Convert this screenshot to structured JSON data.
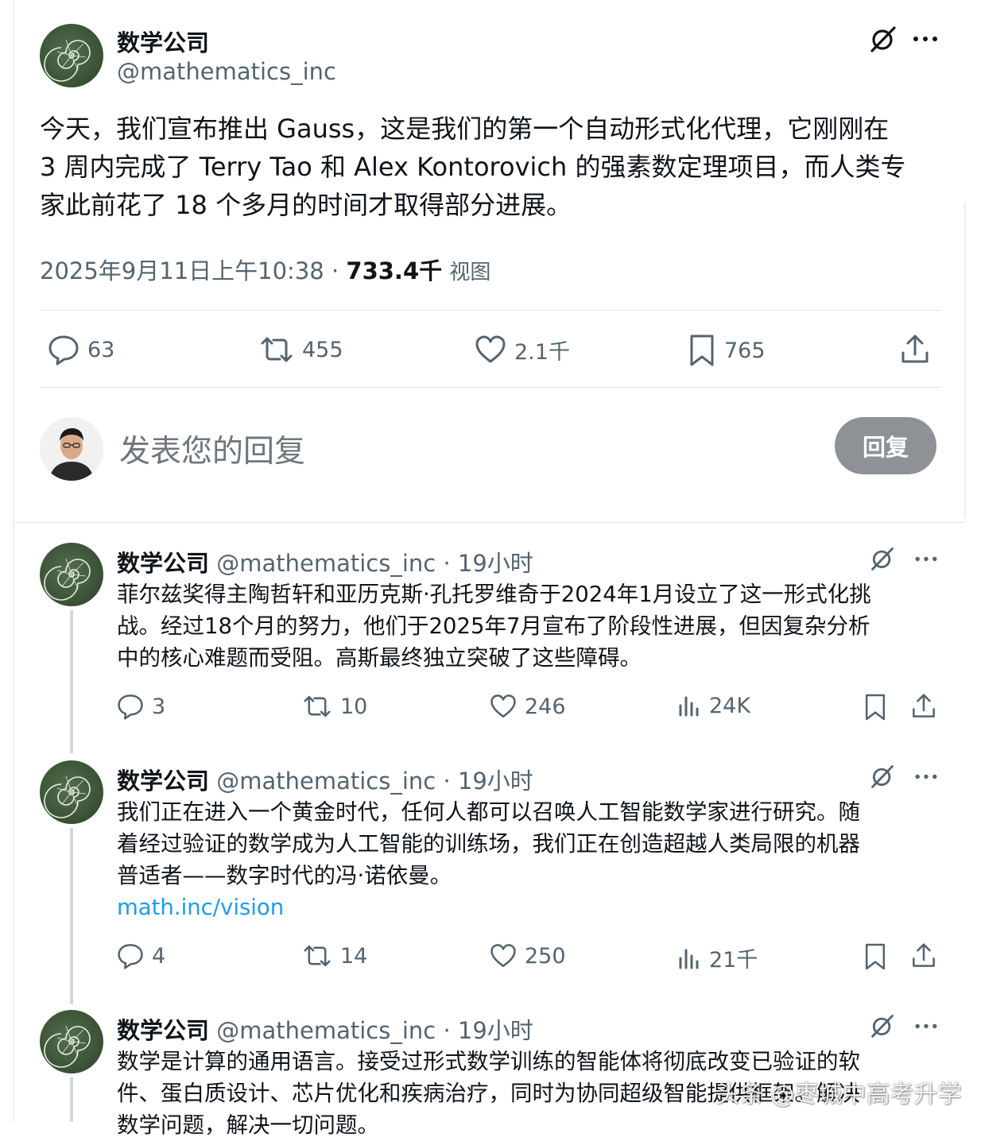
{
  "main_post": {
    "display_name": "数学公司",
    "handle": "@mathematics_inc",
    "text_lines": [
      "今天，我们宣布推出 Gauss，这是我们的第一个自动形式化代理，它刚刚在",
      "3 周内完成了 Terry Tao 和 Alex Kontorovich 的强素数定理项目，而人类专",
      "家此前花了 18 个多月的时间才取得部分进展。"
    ],
    "timestamp": "2025年9月11日上午10:38",
    "separator": "·",
    "views_count": "733.4千",
    "views_label": "视图",
    "replies": "63",
    "reposts": "455",
    "likes": "2.1千",
    "bookmarks": "765"
  },
  "reply_box": {
    "placeholder": "发表您的回复",
    "button_label": "回复"
  },
  "replies": [
    {
      "display_name": "数学公司",
      "handle": "@mathematics_inc",
      "time": "· 19小时",
      "text_lines": [
        "菲尔兹奖得主陶哲轩和亚历克斯·孔托罗维奇于2024年1月设立了这一形式化挑",
        "战。经过18个月的努力，他们于2025年7月宣布了阶段性进展，但因复杂分析",
        "中的核心难题而受阻。高斯最终独立突破了这些障碍。"
      ],
      "link": "",
      "replies": "3",
      "reposts": "10",
      "likes": "246",
      "views": "24K"
    },
    {
      "display_name": "数学公司",
      "handle": "@mathematics_inc",
      "time": "· 19小时",
      "text_lines": [
        "我们正在进入一个黄金时代，任何人都可以召唤人工智能数学家进行研究。随",
        "着经过验证的数学成为人工智能的训练场，我们正在创造超越人类局限的机器",
        "普适者——数字时代的冯·诺依曼。"
      ],
      "link": "math.inc/vision",
      "replies": "4",
      "reposts": "14",
      "likes": "250",
      "views": "21千"
    },
    {
      "display_name": "数学公司",
      "handle": "@mathematics_inc",
      "time": "· 19小时",
      "text_lines": [
        "数学是计算的通用语言。接受过形式数学训练的智能体将彻底改变已验证的软",
        "件、蛋白质设计、芯片优化和疾病治疗，同时为协同超级智能提供框架。解决",
        "数学问题，解决一切问题。"
      ],
      "link": "",
      "replies": "",
      "reposts": "",
      "likes": "",
      "views": ""
    }
  ],
  "watermark": "头条 @枣城中高考升学",
  "icons": {
    "grok": "grok-icon",
    "more": "more-icon",
    "reply": "reply-icon",
    "repost": "repost-icon",
    "like": "heart-icon",
    "bookmark": "bookmark-icon",
    "share": "share-icon",
    "views": "views-icon"
  },
  "colors": {
    "link": "#1d9bf0",
    "secondary_text": "#536471",
    "reply_button": "#8e9195",
    "avatar_green": "#3e5639"
  }
}
